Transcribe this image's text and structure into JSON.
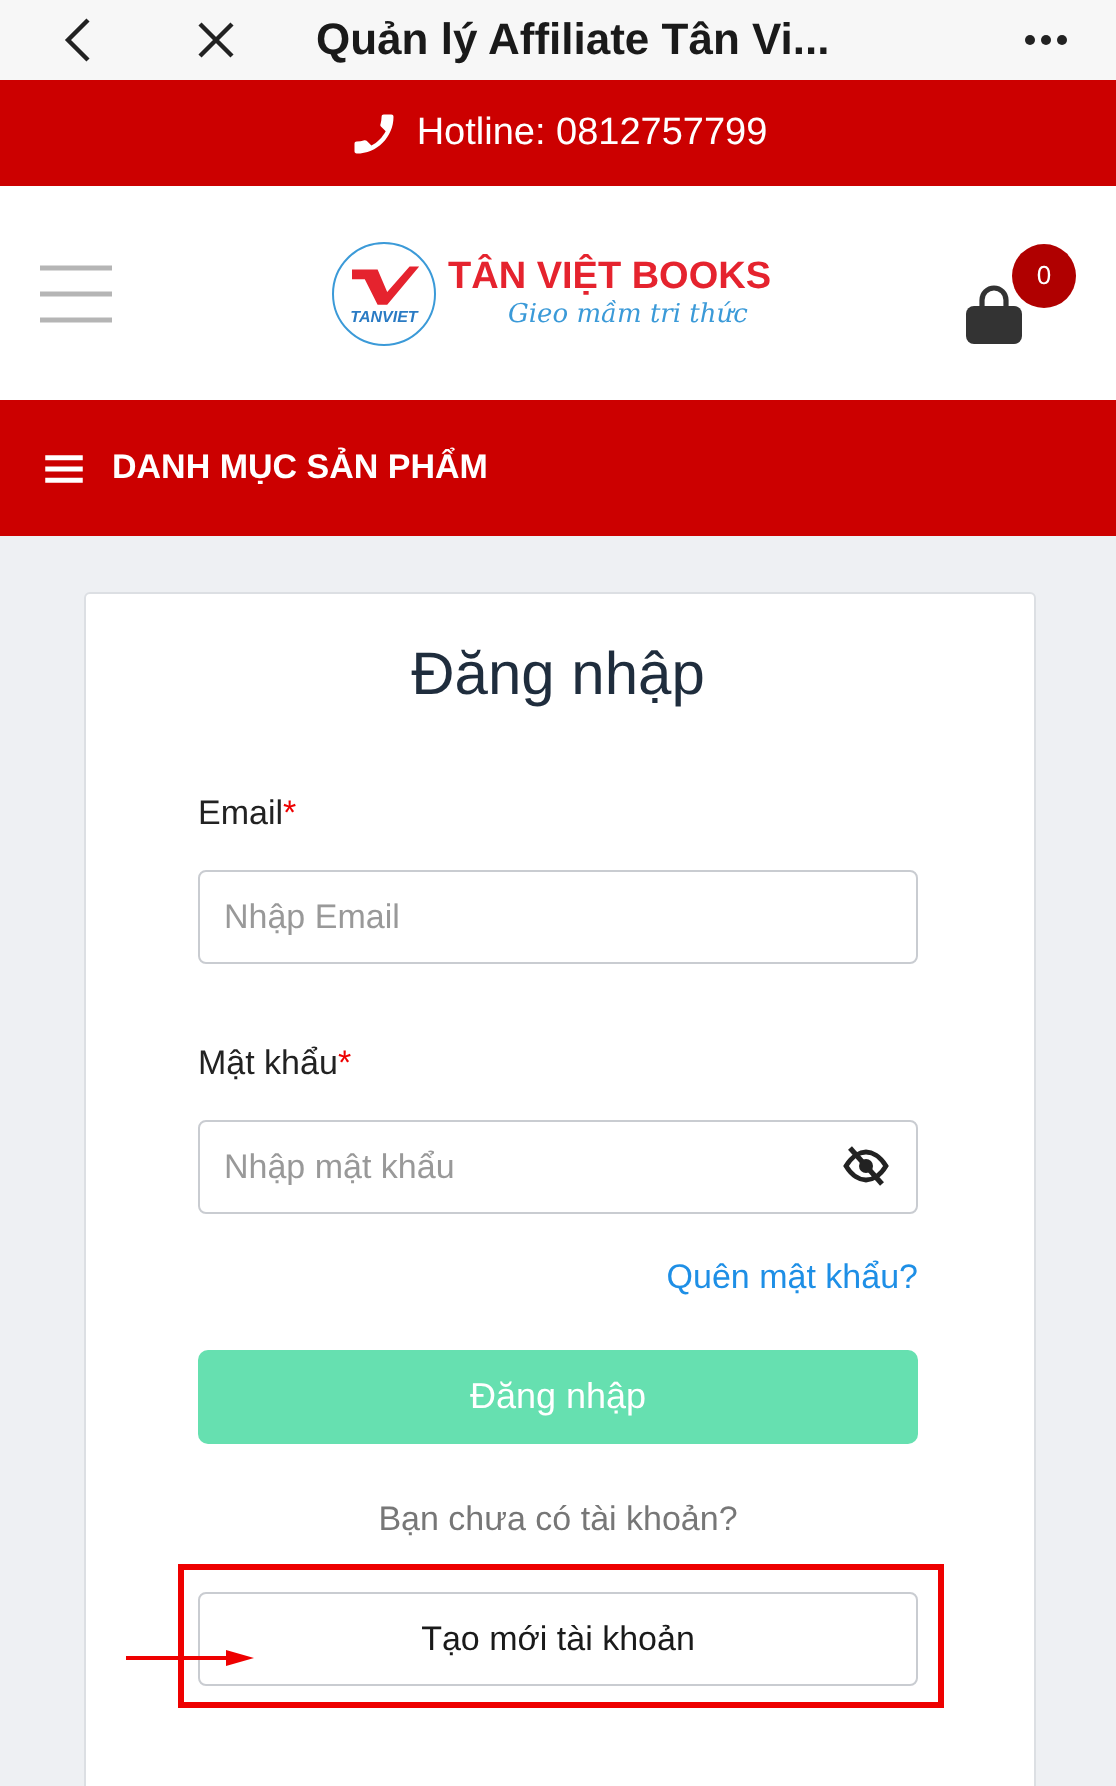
{
  "browser_bar": {
    "title": "Quản lý Affiliate Tân Vi..."
  },
  "hotline": {
    "text": "Hotline: 0812757799"
  },
  "header": {
    "logo_mark": "TANVIET",
    "brand": "TÂN VIỆT BOOKS",
    "slogan": "Gieo mầm tri thức",
    "cart_count": "0"
  },
  "category_bar": {
    "label": "DANH MỤC SẢN PHẨM"
  },
  "login_form": {
    "title": "Đăng nhập",
    "fields": [
      {
        "label": "Email",
        "required_mark": "*",
        "placeholder": "Nhập Email",
        "kind": "text"
      },
      {
        "label": "Mật khẩu",
        "required_mark": "*",
        "placeholder": "Nhập mật khẩu",
        "kind": "password"
      }
    ],
    "forgot_link": "Quên mật khẩu?",
    "submit_button": {
      "label": "Đăng nhập",
      "disabled": true
    },
    "signup_prompt": "Bạn chưa có tài khoản?",
    "signup_button": {
      "label": "Tạo mới tài khoản",
      "highlighted": true
    }
  }
}
